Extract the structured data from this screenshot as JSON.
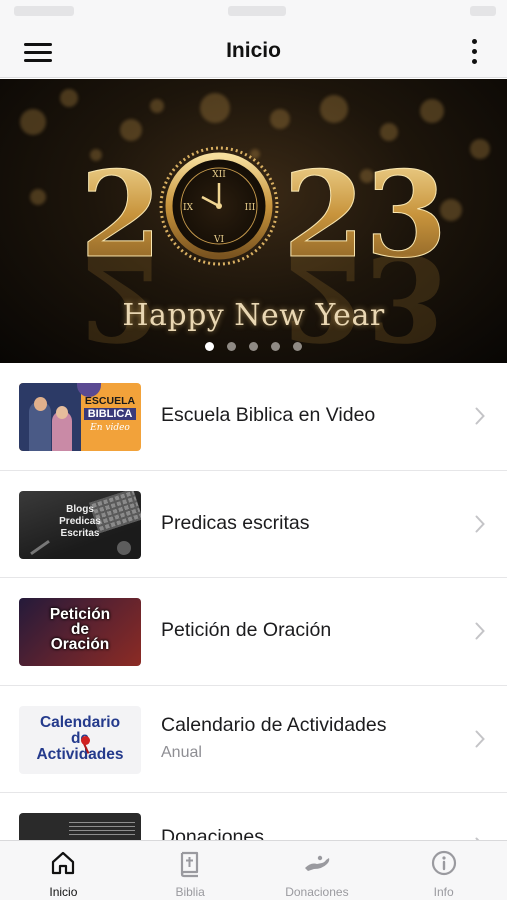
{
  "header": {
    "title": "Inicio",
    "menu_icon": "hamburger-menu-icon",
    "more_icon": "more-vertical-icon"
  },
  "banner": {
    "year": "2023",
    "caption": "Happy New Year",
    "slides": 5,
    "active_slide": 1,
    "accent_color": "#d4a84a"
  },
  "list": {
    "items": [
      {
        "title": "Escuela Biblica en Video",
        "subtitle": "",
        "thumb_text": [
          "ESCUELA",
          "BIBLICA",
          "En video"
        ]
      },
      {
        "title": "Predicas escritas",
        "subtitle": "",
        "thumb_text": [
          "Blogs",
          "Predicas",
          "Escritas"
        ]
      },
      {
        "title": "Petición de Oración",
        "subtitle": "",
        "thumb_text": [
          "Petición",
          "de",
          "Oración"
        ]
      },
      {
        "title": "Calendario de Actividades",
        "subtitle": "Anual",
        "thumb_text": [
          "Calendario",
          "de",
          "Actividades"
        ]
      },
      {
        "title": "Donaciones",
        "subtitle": ""
      }
    ]
  },
  "tabbar": {
    "tabs": [
      {
        "label": "Inicio",
        "icon": "home-icon",
        "active": true
      },
      {
        "label": "Biblia",
        "icon": "bible-icon",
        "active": false
      },
      {
        "label": "Donaciones",
        "icon": "donation-hand-icon",
        "active": false
      },
      {
        "label": "Info",
        "icon": "info-icon",
        "active": false
      }
    ]
  }
}
